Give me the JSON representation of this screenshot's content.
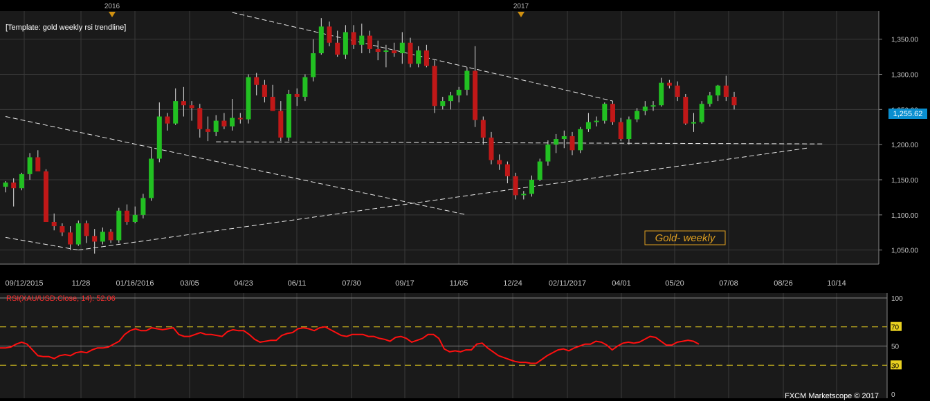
{
  "window": {
    "template_label": "[Template: gold weekly rsi trendline]",
    "watermark": "Gold- weekly",
    "footer": "FXCM Marketscope © 2017",
    "year_markers": [
      "2016",
      "2017"
    ],
    "last_price": "1,255.62"
  },
  "colors": {
    "background": "#1a1a1a",
    "grid": "#3a3a3a",
    "bull": "#22c022",
    "bear": "#c01818",
    "rsi_line": "#ff1010",
    "rsi_level": "#e8d020",
    "accent": "#e0a020",
    "price_badge": "#0a8fd0"
  },
  "chart_data": [
    {
      "type": "candlestick",
      "title": "Gold- weekly",
      "symbol": "XAU/USD",
      "timeframe": "weekly",
      "grid": true,
      "ylim": [
        1030,
        1390
      ],
      "y_ticks": [
        "1,050.00",
        "1,100.00",
        "1,150.00",
        "1,200.00",
        "1,250.00",
        "1,300.00",
        "1,350.00"
      ],
      "y_tick_values": [
        1050,
        1100,
        1150,
        1200,
        1250,
        1300,
        1350
      ],
      "x_ticks": [
        "09/12/2015",
        "11/28",
        "01/16/2016",
        "03/05",
        "04/23",
        "06/11",
        "07/30",
        "09/17",
        "11/05",
        "12/24",
        "02/11/2017",
        "04/01",
        "05/20",
        "07/08",
        "08/26",
        "10/14"
      ],
      "last_price": 1255.62,
      "candles": [
        [
          1140,
          1148,
          1132,
          1146
        ],
        [
          1146,
          1152,
          1112,
          1138
        ],
        [
          1138,
          1160,
          1135,
          1158
        ],
        [
          1158,
          1188,
          1150,
          1182
        ],
        [
          1182,
          1192,
          1165,
          1162
        ],
        [
          1162,
          1165,
          1095,
          1090
        ],
        [
          1090,
          1102,
          1078,
          1084
        ],
        [
          1084,
          1088,
          1070,
          1075
        ],
        [
          1075,
          1084,
          1050,
          1058
        ],
        [
          1058,
          1092,
          1056,
          1088
        ],
        [
          1088,
          1092,
          1060,
          1070
        ],
        [
          1070,
          1080,
          1045,
          1062
        ],
        [
          1062,
          1082,
          1058,
          1076
        ],
        [
          1076,
          1080,
          1060,
          1064
        ],
        [
          1064,
          1110,
          1060,
          1106
        ],
        [
          1106,
          1115,
          1086,
          1090
        ],
        [
          1090,
          1112,
          1088,
          1100
        ],
        [
          1100,
          1130,
          1095,
          1124
        ],
        [
          1124,
          1195,
          1120,
          1180
        ],
        [
          1180,
          1260,
          1175,
          1240
        ],
        [
          1240,
          1245,
          1220,
          1230
        ],
        [
          1230,
          1280,
          1228,
          1262
        ],
        [
          1262,
          1282,
          1240,
          1256
        ],
        [
          1256,
          1262,
          1234,
          1252
        ],
        [
          1252,
          1258,
          1210,
          1222
        ],
        [
          1222,
          1240,
          1205,
          1218
        ],
        [
          1218,
          1242,
          1212,
          1234
        ],
        [
          1234,
          1245,
          1222,
          1226
        ],
        [
          1226,
          1265,
          1220,
          1238
        ],
        [
          1238,
          1245,
          1230,
          1236
        ],
        [
          1236,
          1300,
          1230,
          1296
        ],
        [
          1296,
          1302,
          1270,
          1285
        ],
        [
          1285,
          1292,
          1260,
          1268
        ],
        [
          1268,
          1285,
          1252,
          1248
        ],
        [
          1248,
          1262,
          1205,
          1210
        ],
        [
          1210,
          1278,
          1205,
          1272
        ],
        [
          1272,
          1280,
          1255,
          1268
        ],
        [
          1268,
          1300,
          1262,
          1296
        ],
        [
          1296,
          1350,
          1290,
          1330
        ],
        [
          1330,
          1380,
          1328,
          1368
        ],
        [
          1368,
          1375,
          1340,
          1345
        ],
        [
          1345,
          1362,
          1325,
          1328
        ],
        [
          1328,
          1370,
          1322,
          1360
        ],
        [
          1360,
          1370,
          1336,
          1342
        ],
        [
          1342,
          1372,
          1330,
          1355
        ],
        [
          1355,
          1362,
          1330,
          1336
        ],
        [
          1336,
          1348,
          1320,
          1332
        ],
        [
          1332,
          1342,
          1310,
          1334
        ],
        [
          1334,
          1345,
          1325,
          1330
        ],
        [
          1330,
          1360,
          1315,
          1345
        ],
        [
          1345,
          1352,
          1310,
          1315
        ],
        [
          1315,
          1340,
          1310,
          1334
        ],
        [
          1334,
          1342,
          1310,
          1312
        ],
        [
          1312,
          1320,
          1245,
          1255
        ],
        [
          1255,
          1268,
          1250,
          1262
        ],
        [
          1262,
          1275,
          1250,
          1270
        ],
        [
          1270,
          1282,
          1260,
          1278
        ],
        [
          1278,
          1310,
          1270,
          1305
        ],
        [
          1305,
          1340,
          1225,
          1235
        ],
        [
          1235,
          1240,
          1200,
          1210
        ],
        [
          1210,
          1218,
          1172,
          1178
        ],
        [
          1178,
          1186,
          1164,
          1172
        ],
        [
          1172,
          1176,
          1145,
          1155
        ],
        [
          1155,
          1160,
          1122,
          1128
        ],
        [
          1128,
          1134,
          1122,
          1130
        ],
        [
          1130,
          1156,
          1126,
          1150
        ],
        [
          1150,
          1180,
          1148,
          1176
        ],
        [
          1176,
          1206,
          1170,
          1200
        ],
        [
          1200,
          1215,
          1188,
          1208
        ],
        [
          1208,
          1220,
          1195,
          1212
        ],
        [
          1212,
          1218,
          1185,
          1192
        ],
        [
          1192,
          1225,
          1188,
          1222
        ],
        [
          1222,
          1245,
          1218,
          1232
        ],
        [
          1232,
          1240,
          1226,
          1234
        ],
        [
          1234,
          1260,
          1230,
          1258
        ],
        [
          1258,
          1262,
          1228,
          1232
        ],
        [
          1232,
          1238,
          1205,
          1208
        ],
        [
          1208,
          1240,
          1200,
          1236
        ],
        [
          1236,
          1252,
          1232,
          1248
        ],
        [
          1248,
          1262,
          1242,
          1254
        ],
        [
          1254,
          1262,
          1248,
          1256
        ],
        [
          1256,
          1295,
          1254,
          1288
        ],
        [
          1288,
          1292,
          1280,
          1284
        ],
        [
          1284,
          1290,
          1262,
          1268
        ],
        [
          1268,
          1272,
          1228,
          1230
        ],
        [
          1230,
          1245,
          1218,
          1232
        ],
        [
          1232,
          1262,
          1230,
          1258
        ],
        [
          1258,
          1275,
          1254,
          1270
        ],
        [
          1270,
          1285,
          1262,
          1284
        ],
        [
          1284,
          1298,
          1262,
          1268
        ],
        [
          1268,
          1275,
          1250,
          1256
        ]
      ],
      "trendlines": [
        {
          "style": "dashed",
          "x": [
            0,
            57
          ],
          "y": [
            1240,
            1100
          ]
        },
        {
          "style": "dashed",
          "x": [
            0,
            9
          ],
          "y": [
            1068,
            1050
          ]
        },
        {
          "style": "dashed",
          "x": [
            9,
            99
          ],
          "y": [
            1050,
            1195
          ]
        },
        {
          "style": "dashed",
          "x": [
            26,
            101
          ],
          "y": [
            1204,
            1201
          ]
        },
        {
          "style": "dashed",
          "x": [
            28,
            75
          ],
          "y": [
            1388,
            1262
          ]
        }
      ]
    },
    {
      "type": "line",
      "title": "RSI(XAU/USD.Close, 14): 52.06",
      "ylim": [
        0,
        100
      ],
      "y_ticks": [
        "100",
        "70",
        "50",
        "30",
        "0"
      ],
      "levels": [
        70,
        50,
        30
      ],
      "series": [
        {
          "name": "RSI(XAU/USD.Close, 14): 52.06",
          "values": [
            48,
            48,
            49,
            52,
            54,
            52,
            46,
            40,
            39,
            39,
            37,
            40,
            41,
            40,
            43,
            44,
            43,
            46,
            48,
            48,
            49,
            52,
            55,
            62,
            66,
            68,
            66,
            66,
            69,
            68,
            67,
            68,
            69,
            62,
            60,
            60,
            62,
            64,
            62,
            62,
            61,
            60,
            65,
            67,
            66,
            66,
            62,
            57,
            54,
            55,
            56,
            56,
            61,
            63,
            64,
            68,
            69,
            68,
            66,
            69,
            70,
            67,
            64,
            61,
            60,
            62,
            62,
            62,
            60,
            60,
            58,
            57,
            55,
            59,
            60,
            58,
            54,
            56,
            58,
            62,
            62,
            58,
            47,
            44,
            45,
            44,
            46,
            46,
            52,
            53,
            48,
            44,
            40,
            38,
            36,
            34,
            33,
            33,
            32,
            32,
            36,
            40,
            43,
            46,
            47,
            45,
            48,
            50,
            52,
            52,
            55,
            54,
            51,
            46,
            50,
            53,
            54,
            53,
            54,
            57,
            60,
            59,
            55,
            51,
            51,
            54,
            55,
            56,
            55,
            52
          ]
        }
      ]
    }
  ]
}
